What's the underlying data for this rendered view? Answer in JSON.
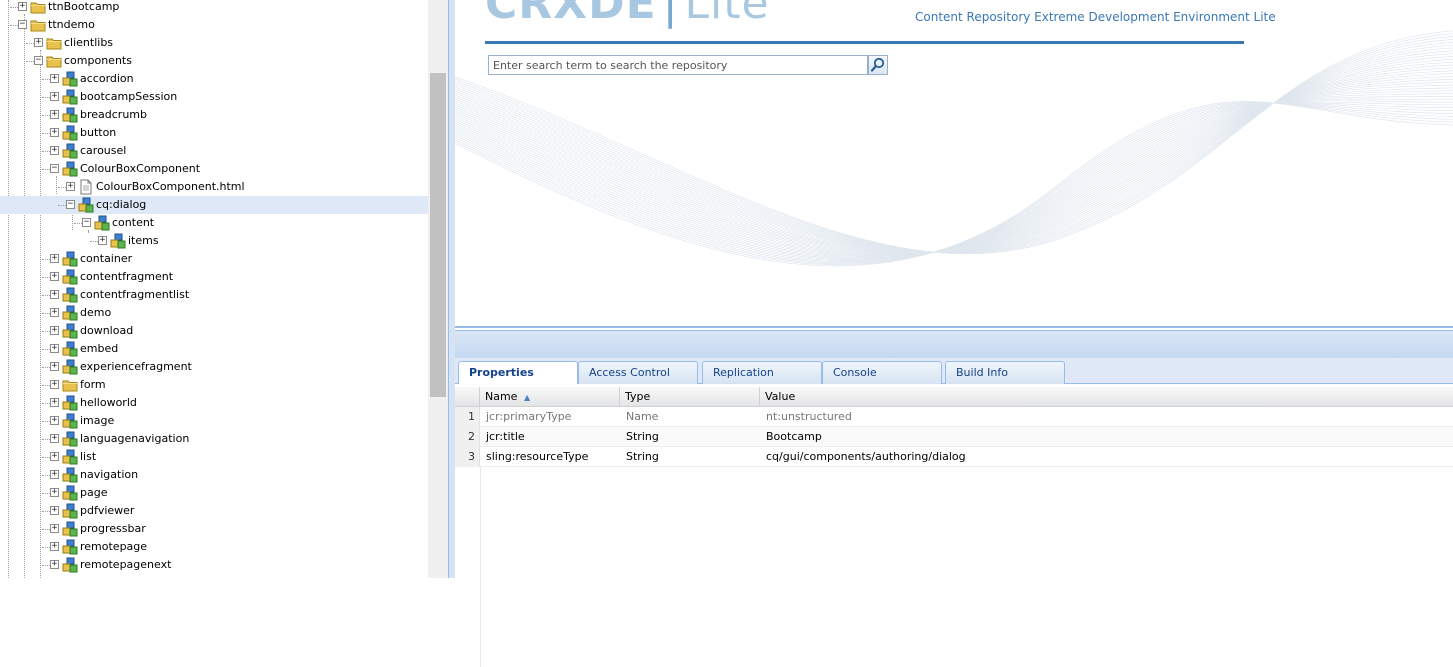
{
  "tree": {
    "items": [
      {
        "label": "ttnBootcamp",
        "depth": 1,
        "expanded": false,
        "icon": "folder-icon"
      },
      {
        "label": "ttndemo",
        "depth": 1,
        "expanded": true,
        "icon": "folder-icon"
      },
      {
        "label": "clientlibs",
        "depth": 2,
        "expanded": false,
        "icon": "folder-icon"
      },
      {
        "label": "components",
        "depth": 2,
        "expanded": true,
        "icon": "folder-icon"
      },
      {
        "label": "accordion",
        "depth": 3,
        "expanded": false,
        "icon": "component-node-icon"
      },
      {
        "label": "bootcampSession",
        "depth": 3,
        "expanded": false,
        "icon": "component-node-icon"
      },
      {
        "label": "breadcrumb",
        "depth": 3,
        "expanded": false,
        "icon": "component-node-icon"
      },
      {
        "label": "button",
        "depth": 3,
        "expanded": false,
        "icon": "component-node-icon"
      },
      {
        "label": "carousel",
        "depth": 3,
        "expanded": false,
        "icon": "component-node-icon"
      },
      {
        "label": "ColourBoxComponent",
        "depth": 3,
        "expanded": true,
        "icon": "component-node-icon"
      },
      {
        "label": "ColourBoxComponent.html",
        "depth": 4,
        "expanded": false,
        "icon": "file-icon"
      },
      {
        "label": "cq:dialog",
        "depth": 4,
        "expanded": true,
        "icon": "component-node-icon",
        "selected": true
      },
      {
        "label": "content",
        "depth": 5,
        "expanded": true,
        "icon": "component-node-icon"
      },
      {
        "label": "items",
        "depth": 6,
        "expanded": false,
        "icon": "component-node-icon"
      },
      {
        "label": "container",
        "depth": 3,
        "expanded": false,
        "icon": "component-node-icon"
      },
      {
        "label": "contentfragment",
        "depth": 3,
        "expanded": false,
        "icon": "component-node-icon"
      },
      {
        "label": "contentfragmentlist",
        "depth": 3,
        "expanded": false,
        "icon": "component-node-icon"
      },
      {
        "label": "demo",
        "depth": 3,
        "expanded": false,
        "icon": "component-node-icon"
      },
      {
        "label": "download",
        "depth": 3,
        "expanded": false,
        "icon": "component-node-icon"
      },
      {
        "label": "embed",
        "depth": 3,
        "expanded": false,
        "icon": "component-node-icon"
      },
      {
        "label": "experiencefragment",
        "depth": 3,
        "expanded": false,
        "icon": "component-node-icon"
      },
      {
        "label": "form",
        "depth": 3,
        "expanded": false,
        "icon": "folder-icon"
      },
      {
        "label": "helloworld",
        "depth": 3,
        "expanded": false,
        "icon": "component-node-icon"
      },
      {
        "label": "image",
        "depth": 3,
        "expanded": false,
        "icon": "component-node-icon"
      },
      {
        "label": "languagenavigation",
        "depth": 3,
        "expanded": false,
        "icon": "component-node-icon"
      },
      {
        "label": "list",
        "depth": 3,
        "expanded": false,
        "icon": "component-node-icon"
      },
      {
        "label": "navigation",
        "depth": 3,
        "expanded": false,
        "icon": "component-node-icon"
      },
      {
        "label": "page",
        "depth": 3,
        "expanded": false,
        "icon": "component-node-icon"
      },
      {
        "label": "pdfviewer",
        "depth": 3,
        "expanded": false,
        "icon": "component-node-icon"
      },
      {
        "label": "progressbar",
        "depth": 3,
        "expanded": false,
        "icon": "component-node-icon"
      },
      {
        "label": "remotepage",
        "depth": 3,
        "expanded": false,
        "icon": "component-node-icon"
      },
      {
        "label": "remotepagenext",
        "depth": 3,
        "expanded": false,
        "icon": "component-node-icon"
      }
    ]
  },
  "header": {
    "logo_main": "CRXDE",
    "logo_sub": "Lite",
    "tagline": "Content Repository Extreme Development Environment Lite"
  },
  "search": {
    "placeholder": "Enter search term to search the repository"
  },
  "tabs": [
    {
      "label": "Properties",
      "active": true
    },
    {
      "label": "Access Control",
      "active": false
    },
    {
      "label": "Replication",
      "active": false
    },
    {
      "label": "Console",
      "active": false
    },
    {
      "label": "Build Info",
      "active": false
    }
  ],
  "properties": {
    "columns": [
      "Name",
      "Type",
      "Value"
    ],
    "sort_indicator": "▲",
    "rows": [
      {
        "num": "1",
        "name": "jcr:primaryType",
        "type": "Name",
        "value": "nt:unstructured",
        "readonly": true
      },
      {
        "num": "2",
        "name": "jcr:title",
        "type": "String",
        "value": "Bootcamp",
        "readonly": false
      },
      {
        "num": "3",
        "name": "sling:resourceType",
        "type": "String",
        "value": "cq/gui/components/authoring/dialog",
        "readonly": false
      }
    ]
  },
  "colors": {
    "accent": "#3a78b5",
    "selection": "#dfe8f6",
    "tab_text": "#15428b"
  }
}
